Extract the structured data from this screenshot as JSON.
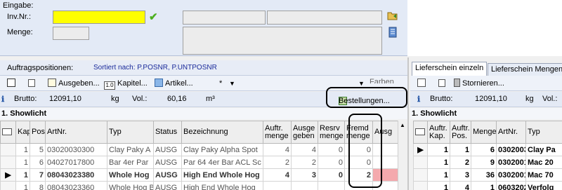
{
  "entry": {
    "group_label": "Eingabe:",
    "inv_label": "Inv.Nr.:",
    "inv_value": "",
    "menge_label": "Menge:",
    "menge_value": "",
    "highlight_color": "#ffff00"
  },
  "positions": {
    "title": "Auftragspositionen:",
    "sort_label": "Sortiert nach: P.POSNR, P.UNTPOSNR"
  },
  "toolbar": {
    "ausgeben": "Ausgeben...",
    "kapitel": "Kapitel...",
    "kapitel_icon_text": "1.0",
    "artikel": "Artikel...",
    "star": "*",
    "farben": "Farben"
  },
  "stats": {
    "brutto_label": "Brutto:",
    "brutto_value": "12091,10",
    "unit_kg": "kg",
    "vol_label": "Vol.:",
    "vol_value": "60,16",
    "unit_m3": "m³",
    "bestellungen": "Bestellungen..."
  },
  "section_title": "1. Showlicht",
  "main_table": {
    "columns": [
      "",
      "Kap",
      "Pos",
      "ArtNr.",
      "Typ",
      "Status",
      "Bezeichnung",
      "Auftr. menge",
      "Ausge geben",
      "Resrv menge",
      "Fremd menge",
      "Ausg"
    ],
    "rows": [
      {
        "marker": "",
        "kap": "1",
        "pos": "5",
        "artnr": "03020030300",
        "typ": "Clay Paky A",
        "status": "AUSG",
        "bez": "Clay Paky Alpha Spot",
        "auftr": "4",
        "ausge": "4",
        "resrv": "0",
        "fremd": "0",
        "style": "normal"
      },
      {
        "marker": "",
        "kap": "1",
        "pos": "6",
        "artnr": "04027017800",
        "typ": "Bar 4er Par",
        "status": "AUSG",
        "bez": "Par 64 4er Bar ACL Sc",
        "auftr": "2",
        "ausge": "2",
        "resrv": "0",
        "fremd": "0",
        "style": "normal"
      },
      {
        "marker": "▶",
        "kap": "1",
        "pos": "7",
        "artnr": "08043023380",
        "typ": "Whole Hog",
        "status": "AUSG",
        "bez": "High End Whole Hog",
        "auftr": "4",
        "ausge": "3",
        "resrv": "0",
        "fremd": "2",
        "style": "bold"
      },
      {
        "marker": "",
        "kap": "1",
        "pos": "8",
        "artnr": "08043023360",
        "typ": "Whole Hog B",
        "status": "AUSG",
        "bez": "High End Whole Hog",
        "auftr": "",
        "ausge": "",
        "resrv": "",
        "fremd": "",
        "style": "normal"
      }
    ]
  },
  "right": {
    "tabs": [
      "Lieferschein einzeln",
      "Lieferschein Mengen"
    ],
    "storno": "Stornieren...",
    "brutto_label": "Brutto:",
    "brutto_value": "12091,10",
    "unit_kg": "kg",
    "vol_label": "Vol.:",
    "section_title": "1. Showlicht",
    "columns": [
      "",
      "Auftr. Kap.",
      "Auftr. Pos.",
      "Menge",
      "ArtNr.",
      "Typ"
    ],
    "rows": [
      {
        "marker": "▶",
        "kap": "1",
        "pos": "1",
        "menge": "6",
        "artnr": "0302003",
        "typ": "Clay Pa"
      },
      {
        "marker": "",
        "kap": "1",
        "pos": "2",
        "menge": "9",
        "artnr": "0302001",
        "typ": "Mac 20"
      },
      {
        "marker": "",
        "kap": "1",
        "pos": "3",
        "menge": "36",
        "artnr": "0302001",
        "typ": "Mac 70"
      },
      {
        "marker": "",
        "kap": "1",
        "pos": "4",
        "menge": "1",
        "artnr": "0603202",
        "typ": "Verfolg"
      }
    ]
  }
}
